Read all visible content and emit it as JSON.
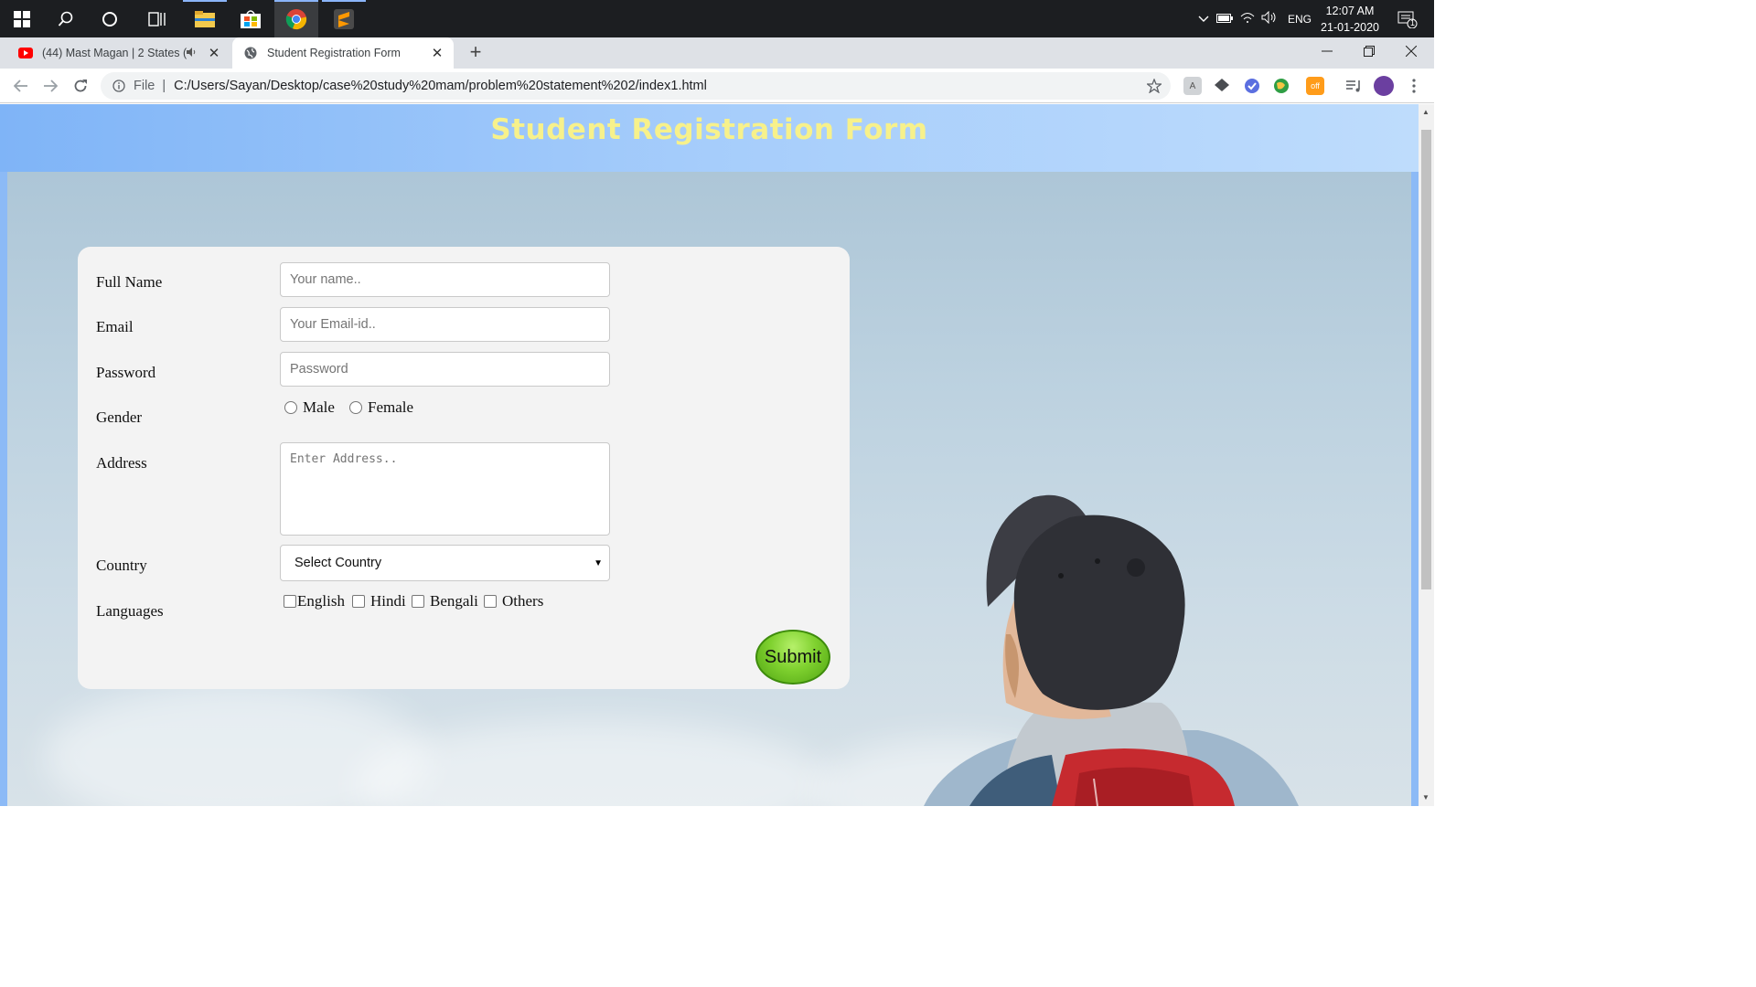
{
  "taskbar": {
    "clock_time": "12:07 AM",
    "clock_date": "21-01-2020",
    "language": "ENG",
    "notification_count": "1"
  },
  "tabs": [
    {
      "title": "(44) Mast Magan | 2 States (2",
      "active": false,
      "favicon": "youtube-icon"
    },
    {
      "title": "Student Registration Form",
      "active": true,
      "favicon": "globe-icon"
    }
  ],
  "address_bar": {
    "scheme_label": "File",
    "url": "C:/Users/Sayan/Desktop/case%20study%20mam/problem%20statement%202/index1.html"
  },
  "page": {
    "heading": "Student Registration Form",
    "form": {
      "full_name": {
        "label": "Full Name",
        "placeholder": "Your name.."
      },
      "email": {
        "label": "Email",
        "placeholder": "Your Email-id.."
      },
      "password": {
        "label": "Password",
        "placeholder": "Password"
      },
      "gender": {
        "label": "Gender",
        "options": [
          "Male",
          "Female"
        ]
      },
      "address": {
        "label": "Address",
        "placeholder": "Enter Address.."
      },
      "country": {
        "label": "Country",
        "selected": "Select Country"
      },
      "languages": {
        "label": "Languages",
        "options": [
          "English",
          "Hindi",
          "Bengali",
          "Others"
        ]
      },
      "submit_label": "Submit"
    }
  },
  "colors": {
    "heading_text": "#f7f18b",
    "header_bg": "#a6cdfb",
    "submit_bg": "#7fd12f",
    "taskbar_bg": "#1c1e21"
  }
}
